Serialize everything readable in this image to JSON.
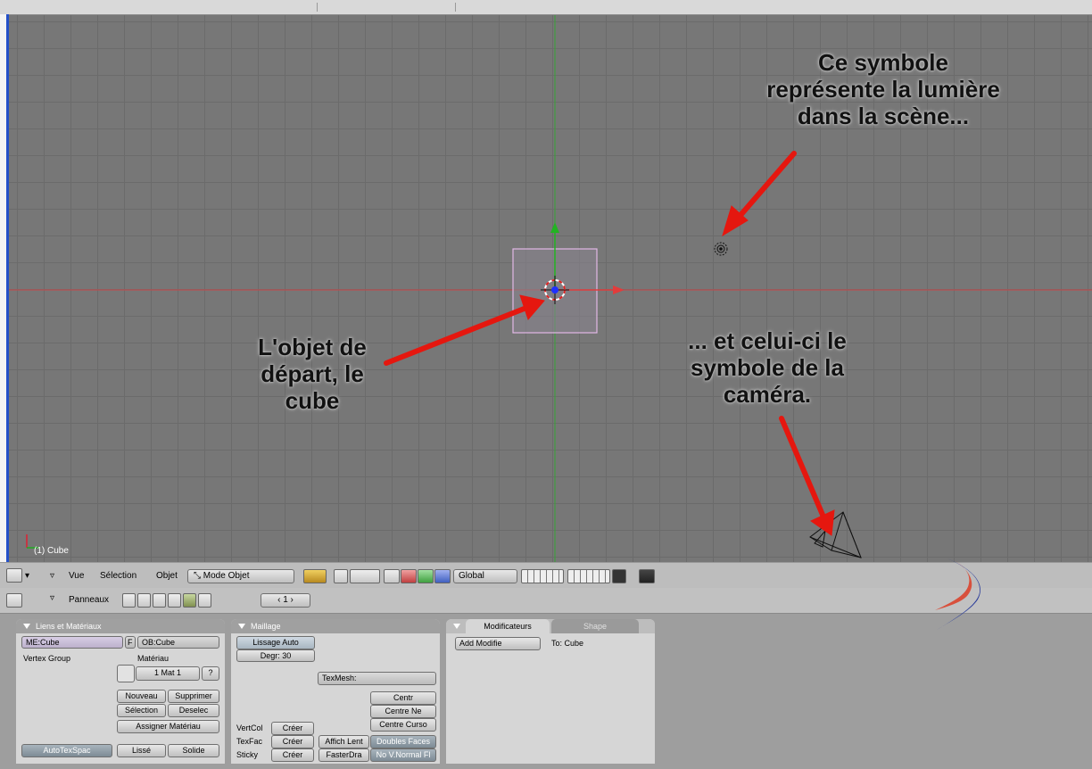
{
  "viewport": {
    "annotation_light": "Ce symbole\nreprésente la lumière\ndans la scène...",
    "annotation_cube": "L'objet de\ndépart, le\ncube",
    "annotation_camera": "... et celui-ci le\nsymbole de la\ncaméra.",
    "object_label": "(1) Cube",
    "colors": {
      "background": "#777777",
      "grid": "#6b6b6b",
      "x_axis": "#d24a4a",
      "y_axis": "#2fa02f",
      "arrow": "#e5170f",
      "cube_outline": "#e2b8e6"
    }
  },
  "header": {
    "menu_vue": "Vue",
    "menu_selection": "Sélection",
    "menu_objet": "Objet",
    "mode_select": "Mode Objet",
    "transform_orientation": "Global",
    "icons": [
      "grid-icon",
      "pivot-icon",
      "hand-icon",
      "move-icon",
      "rotate-icon",
      "scale-icon",
      "lock-icon",
      "render-icon"
    ]
  },
  "buttons_window": {
    "panels_label": "Panneaux",
    "frame_value": "1",
    "links_panel": {
      "title": "Liens et Matériaux",
      "me_field": "ME:Cube",
      "f_label": "F",
      "ob_field": "OB:Cube",
      "vertex_group": "Vertex Group",
      "material_label": "Matériau",
      "mat_value": "1 Mat 1",
      "question": "?",
      "nouveau": "Nouveau",
      "supprimer": "Supprimer",
      "selection": "Sélection",
      "deselec": "Deselec",
      "assigner": "Assigner Matériau",
      "autotexspace": "AutoTexSpac",
      "lisse": "Lissé",
      "solide": "Solide"
    },
    "mesh_panel": {
      "title": "Maillage",
      "lissage_auto": "Lissage Auto",
      "degr": "Degr: 30",
      "texmesh": "TexMesh:",
      "centr": "Centr",
      "centre_ne": "Centre Ne",
      "centre_curso": "Centre Curso",
      "vertcol": "VertCol",
      "texfac": "TexFac",
      "sticky": "Sticky",
      "creer": "Créer",
      "affich_lent": "Affich Lent",
      "doubles_faces": "Doubles Faces",
      "fasterdra": "FasterDra",
      "no_vnormal": "No V.Normal Fl"
    },
    "modifiers_panel": {
      "tab_modificateurs": "Modificateurs",
      "tab_shape": "Shape",
      "add_modifier": "Add Modifie",
      "to_label": "To: Cube"
    }
  }
}
